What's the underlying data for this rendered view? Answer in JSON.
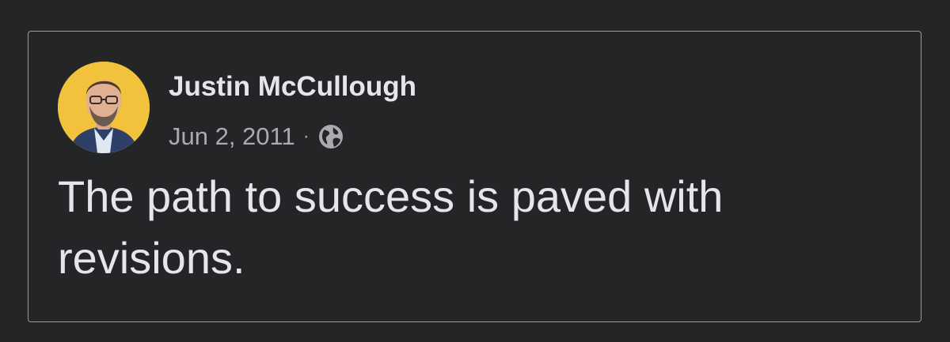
{
  "post": {
    "author": {
      "name": "Justin McCullough",
      "avatar_icon": "profile-photo"
    },
    "date": "Jun 2, 2011",
    "separator": "·",
    "privacy_icon": "globe-icon",
    "text": "The path to success is paved with revisions."
  },
  "colors": {
    "background": "#242527",
    "card_border": "#9a9b9d",
    "primary_text": "#e4e6eb",
    "secondary_text": "#a9abaf",
    "avatar_background": "#f2c23c"
  }
}
